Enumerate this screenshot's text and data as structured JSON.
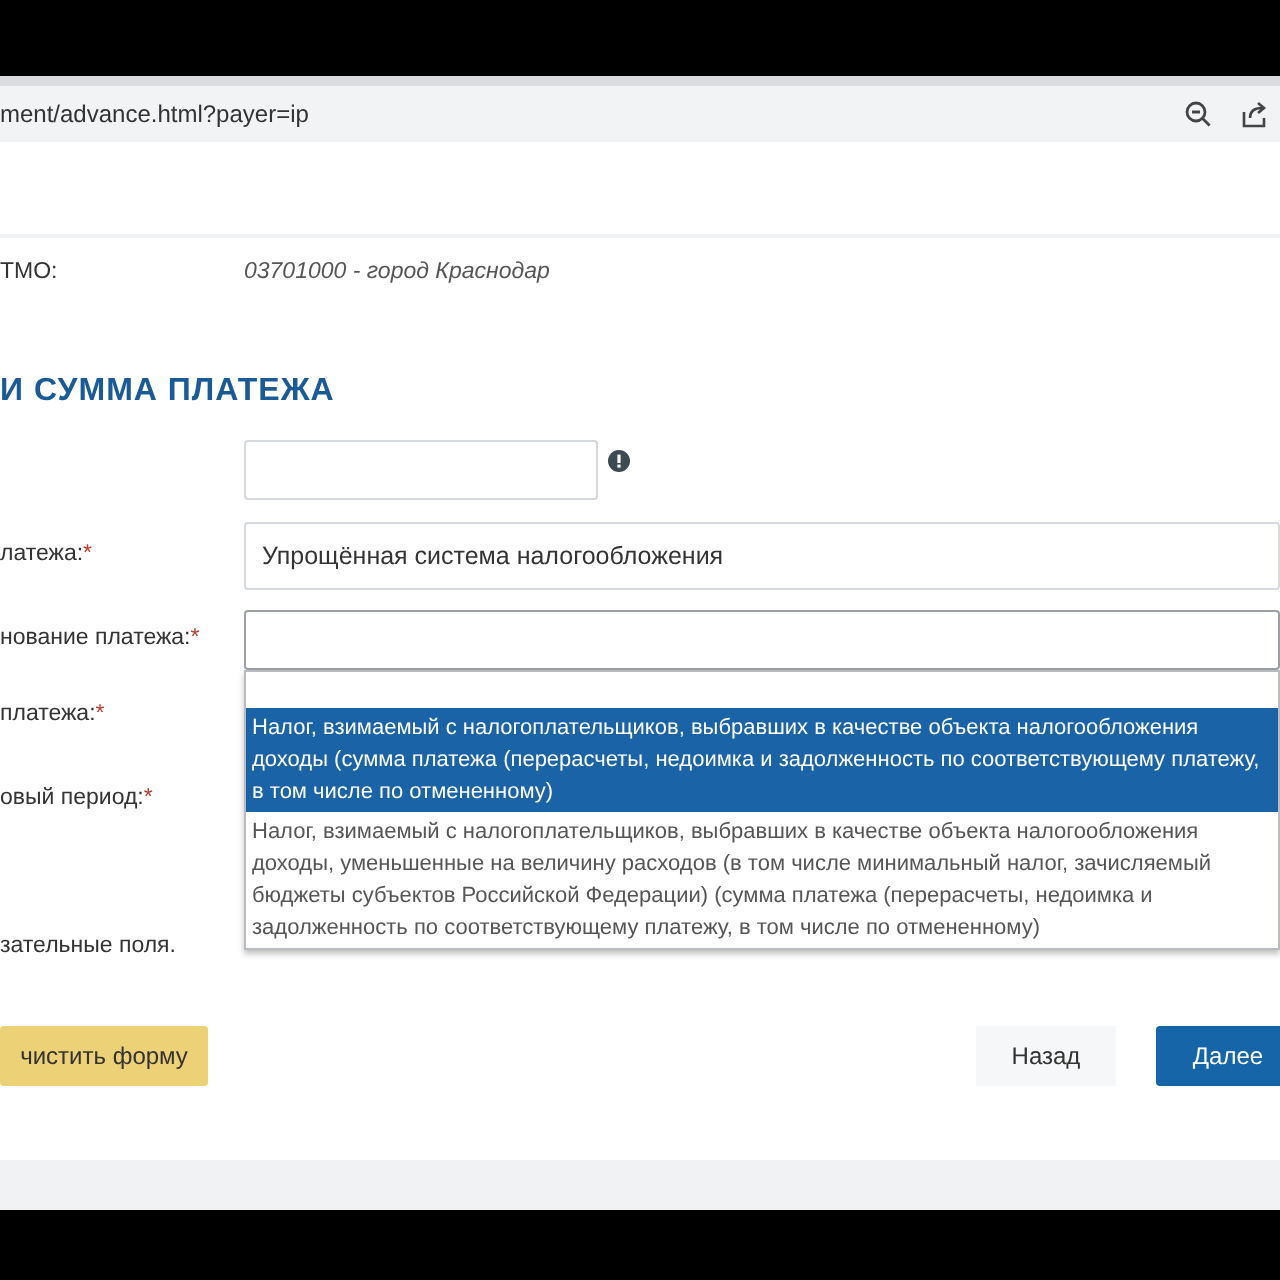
{
  "browser": {
    "url": "ment/advance.html?payer=ip"
  },
  "oktmo": {
    "label": "ТМО:",
    "value": "03701000 - город Краснодар"
  },
  "section_title": "И СУММА ПЛАТЕЖА",
  "fields": [
    {
      "kind": "input",
      "info": true
    },
    {
      "kind": "select",
      "label": "латежа:",
      "required_mark": "*",
      "value": "Упрощённая система налогообложения"
    },
    {
      "kind": "combo",
      "label": "нование платежа:",
      "required_mark": "*",
      "expanded": true,
      "options": [
        {
          "text": "Налог, взимаемый с налогоплательщиков, выбравших в качестве объекта налогообложения доходы (сумма платежа (перерасчеты, недоимка и задолженность по соответствующему платежу, в том числе по отмененному)",
          "selected": true
        },
        {
          "text": "Налог, взимаемый с налогоплательщиков, выбравших в качестве объекта налогообложения доходы, уменьшенные на величину расходов (в том числе минимальный налог, зачисляемый бюджеты субъектов Российской Федерации) (сумма платежа (перерасчеты, недоимка и задолженность по соответствующему платежу, в том числе по отмененному)",
          "selected": false
        }
      ]
    },
    {
      "kind": "label",
      "label": "платежа:",
      "required_mark": "*"
    },
    {
      "kind": "label",
      "label": "овый период:",
      "required_mark": "*"
    }
  ],
  "required_note": "зательные поля.",
  "buttons": [
    {
      "label": "чистить форму",
      "kind": "warning"
    },
    {
      "label": "Назад",
      "kind": "secondary"
    },
    {
      "label": "Далее",
      "kind": "primary"
    }
  ]
}
